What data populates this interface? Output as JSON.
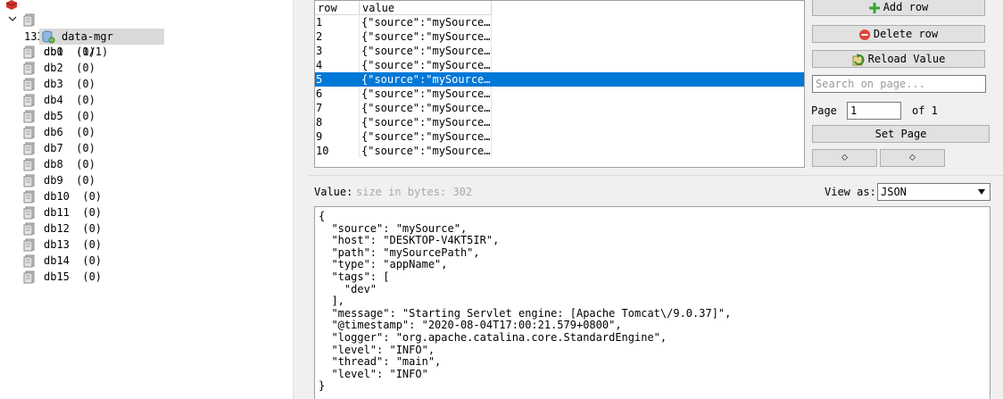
{
  "tree": {
    "server": {
      "label": "133"
    },
    "db0": {
      "label": "db0  (1/1)"
    },
    "selected_key": {
      "label": "data-mgr"
    },
    "dbs": [
      {
        "label": "db1  (0)"
      },
      {
        "label": "db2  (0)"
      },
      {
        "label": "db3  (0)"
      },
      {
        "label": "db4  (0)"
      },
      {
        "label": "db5  (0)"
      },
      {
        "label": "db6  (0)"
      },
      {
        "label": "db7  (0)"
      },
      {
        "label": "db8  (0)"
      },
      {
        "label": "db9  (0)"
      },
      {
        "label": "db10  (0)"
      },
      {
        "label": "db11  (0)"
      },
      {
        "label": "db12  (0)"
      },
      {
        "label": "db13  (0)"
      },
      {
        "label": "db14  (0)"
      },
      {
        "label": "db15  (0)"
      }
    ]
  },
  "table": {
    "columns": [
      "row",
      "value"
    ],
    "rows": [
      {
        "row": "1",
        "value": "{\"source\":\"mySource…"
      },
      {
        "row": "2",
        "value": "{\"source\":\"mySource…"
      },
      {
        "row": "3",
        "value": "{\"source\":\"mySource…"
      },
      {
        "row": "4",
        "value": "{\"source\":\"mySource…"
      },
      {
        "row": "5",
        "value": "{\"source\":\"mySource…"
      },
      {
        "row": "6",
        "value": "{\"source\":\"mySource…"
      },
      {
        "row": "7",
        "value": "{\"source\":\"mySource…"
      },
      {
        "row": "8",
        "value": "{\"source\":\"mySource…"
      },
      {
        "row": "9",
        "value": "{\"source\":\"mySource…"
      },
      {
        "row": "10",
        "value": "{\"source\":\"mySource…"
      }
    ],
    "selected_row": "5"
  },
  "actions": {
    "add_row": "Add row",
    "delete_row": "Delete row",
    "reload_value": "Reload Value",
    "search_placeholder": "Search on page...",
    "page_label": "Page",
    "page_value": "1",
    "of_label": "of 1",
    "set_page": "Set Page",
    "prev_glyph": "⬦",
    "next_glyph": "⬦"
  },
  "value": {
    "label": "Value:",
    "size_hint": "size in bytes: 302",
    "view_as_label": "View as:",
    "view_as_selected": "JSON",
    "content": "{\n  \"source\": \"mySource\",\n  \"host\": \"DESKTOP-V4KT5IR\",\n  \"path\": \"mySourcePath\",\n  \"type\": \"appName\",\n  \"tags\": [\n    \"dev\"\n  ],\n  \"message\": \"Starting Servlet engine: [Apache Tomcat\\/9.0.37]\",\n  \"@timestamp\": \"2020-08-04T17:00:21.579+0800\",\n  \"logger\": \"org.apache.catalina.core.StandardEngine\",\n  \"level\": \"INFO\",\n  \"thread\": \"main\",\n  \"level\": \"INFO\"\n}"
  },
  "colors": {
    "selection": "#0078d7",
    "server_icon": "#d0342c",
    "add_icon": "#3aa33a",
    "delete_icon": "#e0453a"
  }
}
